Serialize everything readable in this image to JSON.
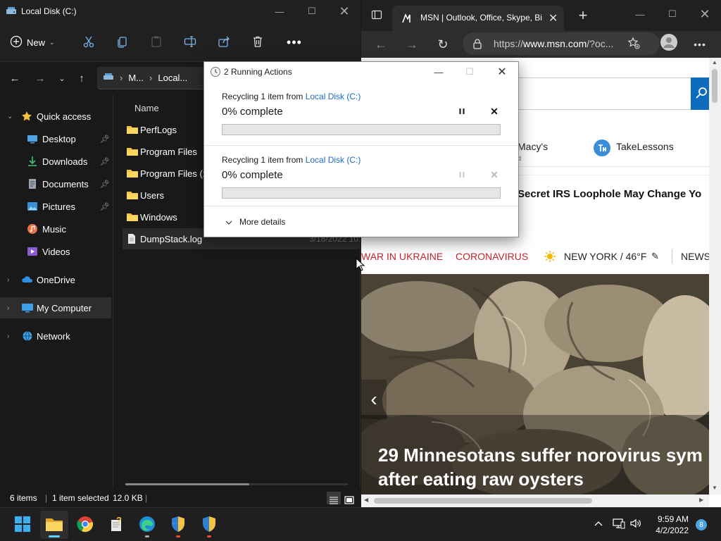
{
  "explorer": {
    "title": "Local Disk (C:)",
    "new_label": "New",
    "breadcrumb": [
      "M...",
      "Local..."
    ],
    "column_name": "Name",
    "sidebar": [
      {
        "label": "Quick access",
        "icon": "star-icon"
      },
      {
        "label": "Desktop",
        "icon": "desktop-icon",
        "pinned": true
      },
      {
        "label": "Downloads",
        "icon": "download-icon",
        "pinned": true
      },
      {
        "label": "Documents",
        "icon": "documents-icon",
        "pinned": true
      },
      {
        "label": "Pictures",
        "icon": "pictures-icon",
        "pinned": true
      },
      {
        "label": "Music",
        "icon": "music-icon"
      },
      {
        "label": "Videos",
        "icon": "videos-icon"
      },
      {
        "label": "OneDrive",
        "icon": "cloud-icon"
      },
      {
        "label": "My Computer",
        "icon": "computer-icon",
        "selected": true
      },
      {
        "label": "Network",
        "icon": "network-icon"
      }
    ],
    "files": [
      {
        "name": "PerfLogs",
        "type": "folder",
        "date": ""
      },
      {
        "name": "Program Files",
        "type": "folder",
        "date": ""
      },
      {
        "name": "Program Files (x8",
        "type": "folder",
        "date": ""
      },
      {
        "name": "Users",
        "type": "folder",
        "date": ""
      },
      {
        "name": "Windows",
        "type": "folder",
        "date": ""
      },
      {
        "name": "DumpStack.log",
        "type": "file",
        "date": "3/18/2022 10:"
      }
    ],
    "status": {
      "items": "6 items",
      "selected": "1 item selected",
      "size": "12.0 KB"
    }
  },
  "browser": {
    "tab_title": "MSN | Outlook, Office, Skype, Bi",
    "url_prefix": "https://",
    "url_host": "www.msn.com",
    "url_rest": "/?oc...",
    "partners": [
      {
        "name": "Macy's",
        "sub": "d"
      },
      {
        "name": "TakeLessons",
        "sub": ""
      }
    ],
    "headline": "Secret IRS Loophole May Change Yo",
    "news_nav": {
      "war": "WAR IN UKRAINE",
      "corona": "CORONAVIRUS",
      "weather": "NEW YORK / 46°F",
      "news": "NEWS"
    },
    "hero_title_1": "29 Minnesotans suffer norovirus sym",
    "hero_title_2": "after eating raw oysters"
  },
  "dialog": {
    "title": "2 Running Actions",
    "ops": [
      {
        "prefix": "Recycling 1 item from ",
        "link": "Local Disk (C:)",
        "percent_text": "0% complete",
        "progress": 0,
        "enabled": true
      },
      {
        "prefix": "Recycling 1 item from ",
        "link": "Local Disk (C:)",
        "percent_text": "0% complete",
        "progress": 0,
        "enabled": false
      }
    ],
    "more_details": "More details"
  },
  "taskbar": {
    "time": "9:59 AM",
    "date": "4/2/2022",
    "notifications": "8"
  },
  "colors": {
    "accent": "#0f6cbd",
    "link": "#1b6ac9",
    "folder": "#f5c342",
    "news_red": "#c4262e"
  }
}
